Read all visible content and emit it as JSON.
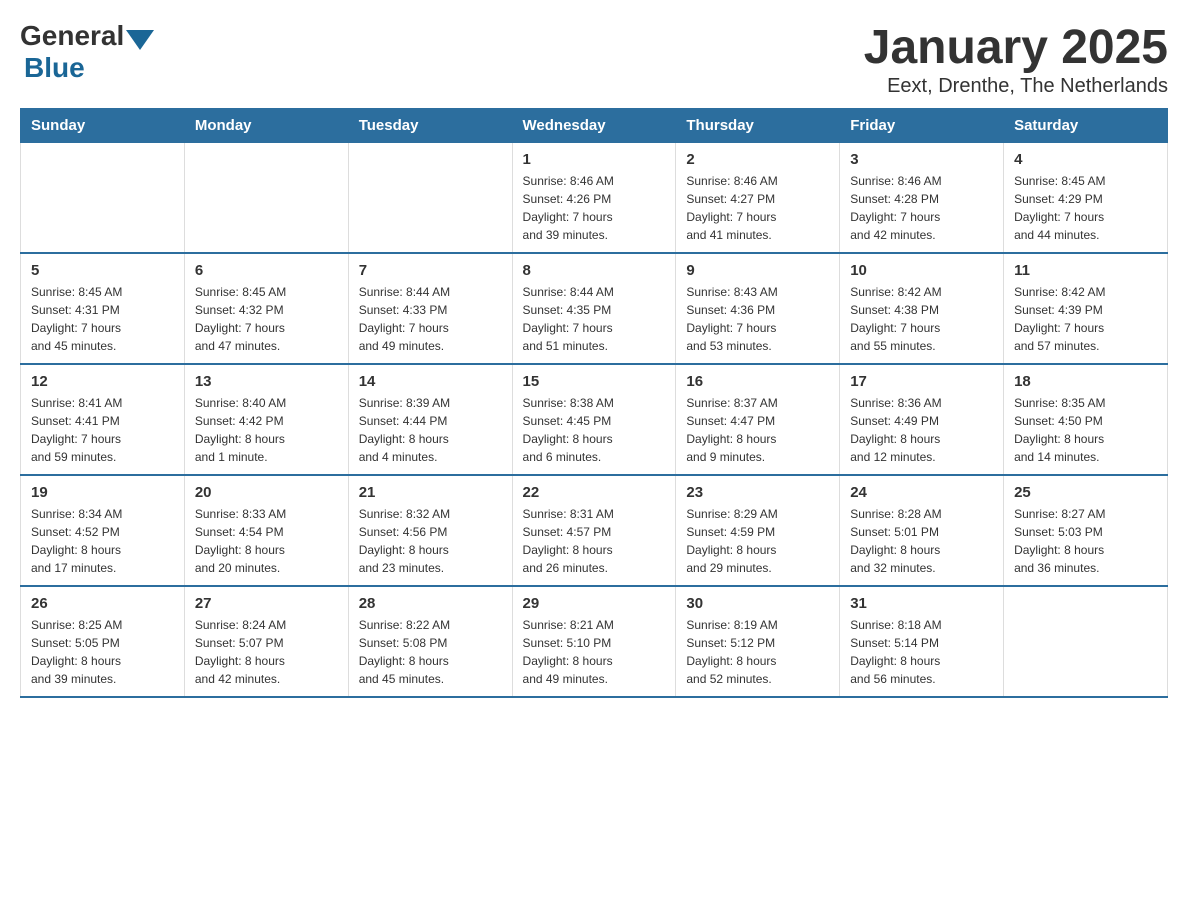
{
  "logo": {
    "general": "General",
    "blue": "Blue"
  },
  "title": "January 2025",
  "subtitle": "Eext, Drenthe, The Netherlands",
  "days_of_week": [
    "Sunday",
    "Monday",
    "Tuesday",
    "Wednesday",
    "Thursday",
    "Friday",
    "Saturday"
  ],
  "weeks": [
    [
      {
        "day": "",
        "info": ""
      },
      {
        "day": "",
        "info": ""
      },
      {
        "day": "",
        "info": ""
      },
      {
        "day": "1",
        "info": "Sunrise: 8:46 AM\nSunset: 4:26 PM\nDaylight: 7 hours\nand 39 minutes."
      },
      {
        "day": "2",
        "info": "Sunrise: 8:46 AM\nSunset: 4:27 PM\nDaylight: 7 hours\nand 41 minutes."
      },
      {
        "day": "3",
        "info": "Sunrise: 8:46 AM\nSunset: 4:28 PM\nDaylight: 7 hours\nand 42 minutes."
      },
      {
        "day": "4",
        "info": "Sunrise: 8:45 AM\nSunset: 4:29 PM\nDaylight: 7 hours\nand 44 minutes."
      }
    ],
    [
      {
        "day": "5",
        "info": "Sunrise: 8:45 AM\nSunset: 4:31 PM\nDaylight: 7 hours\nand 45 minutes."
      },
      {
        "day": "6",
        "info": "Sunrise: 8:45 AM\nSunset: 4:32 PM\nDaylight: 7 hours\nand 47 minutes."
      },
      {
        "day": "7",
        "info": "Sunrise: 8:44 AM\nSunset: 4:33 PM\nDaylight: 7 hours\nand 49 minutes."
      },
      {
        "day": "8",
        "info": "Sunrise: 8:44 AM\nSunset: 4:35 PM\nDaylight: 7 hours\nand 51 minutes."
      },
      {
        "day": "9",
        "info": "Sunrise: 8:43 AM\nSunset: 4:36 PM\nDaylight: 7 hours\nand 53 minutes."
      },
      {
        "day": "10",
        "info": "Sunrise: 8:42 AM\nSunset: 4:38 PM\nDaylight: 7 hours\nand 55 minutes."
      },
      {
        "day": "11",
        "info": "Sunrise: 8:42 AM\nSunset: 4:39 PM\nDaylight: 7 hours\nand 57 minutes."
      }
    ],
    [
      {
        "day": "12",
        "info": "Sunrise: 8:41 AM\nSunset: 4:41 PM\nDaylight: 7 hours\nand 59 minutes."
      },
      {
        "day": "13",
        "info": "Sunrise: 8:40 AM\nSunset: 4:42 PM\nDaylight: 8 hours\nand 1 minute."
      },
      {
        "day": "14",
        "info": "Sunrise: 8:39 AM\nSunset: 4:44 PM\nDaylight: 8 hours\nand 4 minutes."
      },
      {
        "day": "15",
        "info": "Sunrise: 8:38 AM\nSunset: 4:45 PM\nDaylight: 8 hours\nand 6 minutes."
      },
      {
        "day": "16",
        "info": "Sunrise: 8:37 AM\nSunset: 4:47 PM\nDaylight: 8 hours\nand 9 minutes."
      },
      {
        "day": "17",
        "info": "Sunrise: 8:36 AM\nSunset: 4:49 PM\nDaylight: 8 hours\nand 12 minutes."
      },
      {
        "day": "18",
        "info": "Sunrise: 8:35 AM\nSunset: 4:50 PM\nDaylight: 8 hours\nand 14 minutes."
      }
    ],
    [
      {
        "day": "19",
        "info": "Sunrise: 8:34 AM\nSunset: 4:52 PM\nDaylight: 8 hours\nand 17 minutes."
      },
      {
        "day": "20",
        "info": "Sunrise: 8:33 AM\nSunset: 4:54 PM\nDaylight: 8 hours\nand 20 minutes."
      },
      {
        "day": "21",
        "info": "Sunrise: 8:32 AM\nSunset: 4:56 PM\nDaylight: 8 hours\nand 23 minutes."
      },
      {
        "day": "22",
        "info": "Sunrise: 8:31 AM\nSunset: 4:57 PM\nDaylight: 8 hours\nand 26 minutes."
      },
      {
        "day": "23",
        "info": "Sunrise: 8:29 AM\nSunset: 4:59 PM\nDaylight: 8 hours\nand 29 minutes."
      },
      {
        "day": "24",
        "info": "Sunrise: 8:28 AM\nSunset: 5:01 PM\nDaylight: 8 hours\nand 32 minutes."
      },
      {
        "day": "25",
        "info": "Sunrise: 8:27 AM\nSunset: 5:03 PM\nDaylight: 8 hours\nand 36 minutes."
      }
    ],
    [
      {
        "day": "26",
        "info": "Sunrise: 8:25 AM\nSunset: 5:05 PM\nDaylight: 8 hours\nand 39 minutes."
      },
      {
        "day": "27",
        "info": "Sunrise: 8:24 AM\nSunset: 5:07 PM\nDaylight: 8 hours\nand 42 minutes."
      },
      {
        "day": "28",
        "info": "Sunrise: 8:22 AM\nSunset: 5:08 PM\nDaylight: 8 hours\nand 45 minutes."
      },
      {
        "day": "29",
        "info": "Sunrise: 8:21 AM\nSunset: 5:10 PM\nDaylight: 8 hours\nand 49 minutes."
      },
      {
        "day": "30",
        "info": "Sunrise: 8:19 AM\nSunset: 5:12 PM\nDaylight: 8 hours\nand 52 minutes."
      },
      {
        "day": "31",
        "info": "Sunrise: 8:18 AM\nSunset: 5:14 PM\nDaylight: 8 hours\nand 56 minutes."
      },
      {
        "day": "",
        "info": ""
      }
    ]
  ]
}
